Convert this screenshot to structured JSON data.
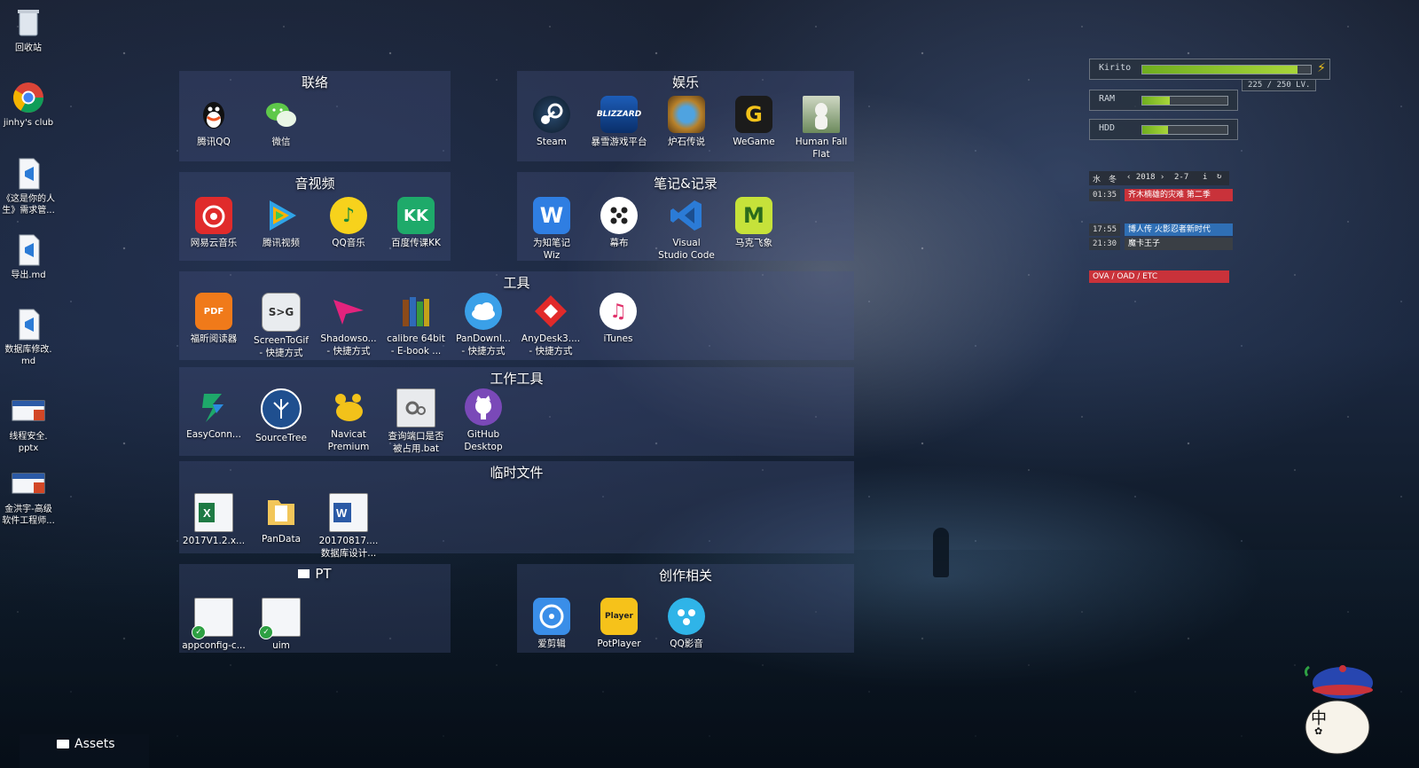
{
  "desktop_icons": [
    {
      "label": "回收站",
      "icon": "recycle-bin-icon"
    },
    {
      "label": "jinhy's club",
      "icon": "chrome-icon"
    },
    {
      "label": "《这是你的人\n生》需求管...",
      "icon": "vscode-file-icon"
    },
    {
      "label": "导出.md",
      "icon": "vscode-file-icon"
    },
    {
      "label": "数据库修改.\nmd",
      "icon": "vscode-file-icon"
    },
    {
      "label": "线程安全.\npptx",
      "icon": "pptx-icon"
    },
    {
      "label": "金洪宇-高级\n软件工程师...",
      "icon": "pptx-icon"
    }
  ],
  "fences": {
    "lianluo": {
      "title": "联络",
      "apps": [
        {
          "label": "腾讯QQ",
          "icon": "qq-icon"
        },
        {
          "label": "微信",
          "icon": "wechat-icon"
        }
      ]
    },
    "yule": {
      "title": "娱乐",
      "apps": [
        {
          "label": "Steam",
          "icon": "steam-icon"
        },
        {
          "label": "暴雪游戏平台",
          "icon": "blizzard-icon"
        },
        {
          "label": "炉石传说",
          "icon": "hearthstone-icon"
        },
        {
          "label": "WeGame",
          "icon": "wegame-icon"
        },
        {
          "label": "Human Fall\nFlat",
          "icon": "human-fall-flat-icon"
        }
      ]
    },
    "yinshipin": {
      "title": "音视频",
      "apps": [
        {
          "label": "网易云音乐",
          "icon": "netease-music-icon"
        },
        {
          "label": "腾讯视频",
          "icon": "tencent-video-icon"
        },
        {
          "label": "QQ音乐",
          "icon": "qq-music-icon"
        },
        {
          "label": "百度传课KK",
          "icon": "baidu-kk-icon"
        }
      ]
    },
    "biji": {
      "title": "笔记&记录",
      "apps": [
        {
          "label": "为知笔记\nWiz",
          "icon": "wiz-icon"
        },
        {
          "label": "幕布",
          "icon": "mubu-icon"
        },
        {
          "label": "Visual\nStudio Code",
          "icon": "vscode-icon"
        },
        {
          "label": "马克飞象",
          "icon": "maxiang-icon"
        }
      ]
    },
    "gongju": {
      "title": "工具",
      "apps": [
        {
          "label": "福昕阅读器",
          "icon": "foxit-icon"
        },
        {
          "label": "ScreenToGif\n- 快捷方式",
          "icon": "screentogif-icon"
        },
        {
          "label": "Shadowso...\n- 快捷方式",
          "icon": "shadowsocks-icon"
        },
        {
          "label": "calibre 64bit\n- E-book ...",
          "icon": "calibre-icon"
        },
        {
          "label": "PanDownl...\n- 快捷方式",
          "icon": "pandownload-icon"
        },
        {
          "label": "AnyDesk3....\n- 快捷方式",
          "icon": "anydesk-icon"
        },
        {
          "label": "iTunes",
          "icon": "itunes-icon"
        }
      ]
    },
    "gongzuo": {
      "title": "工作工具",
      "apps": [
        {
          "label": "EasyConn...",
          "icon": "easyconnect-icon"
        },
        {
          "label": "SourceTree",
          "icon": "sourcetree-icon"
        },
        {
          "label": "Navicat\nPremium",
          "icon": "navicat-icon"
        },
        {
          "label": "查询端口是否\n被占用.bat",
          "icon": "bat-file-icon"
        },
        {
          "label": "GitHub\nDesktop",
          "icon": "github-desktop-icon"
        }
      ]
    },
    "linshi": {
      "title": "临时文件",
      "apps": [
        {
          "label": "2017V1.2.x...",
          "icon": "excel-file-icon"
        },
        {
          "label": "PanData",
          "icon": "folder-icon"
        },
        {
          "label": "20170817....\n数据库设计...",
          "icon": "word-file-icon"
        }
      ]
    },
    "pt": {
      "title": "PT",
      "apps": [
        {
          "label": "appconfig-c...",
          "icon": "synced-file-icon"
        },
        {
          "label": "uim",
          "icon": "synced-file-icon"
        }
      ]
    },
    "chuangzuo": {
      "title": "创作相关",
      "apps": [
        {
          "label": "爱剪辑",
          "icon": "aijianji-icon"
        },
        {
          "label": "PotPlayer",
          "icon": "potplayer-icon"
        },
        {
          "label": "QQ影音",
          "icon": "qq-player-icon"
        }
      ]
    }
  },
  "meters": {
    "kirito": {
      "name": "Kirito",
      "stats": "225 / 250  LV.",
      "level": 0.92
    },
    "ram": {
      "name": "RAM",
      "level": 0.32
    },
    "hdd": {
      "name": "HDD",
      "level": 0.3
    }
  },
  "calendar": {
    "header": [
      "水",
      "冬",
      "‹ 2018 ›",
      "2-7",
      "i",
      "↻"
    ],
    "events": [
      {
        "time": "01:35",
        "title": "齐木楠雄的灾难 第二季",
        "color": "#c9323a"
      },
      {
        "time": "17:55",
        "title": "博人传 火影忍者新时代",
        "color": "#2f6fb5"
      },
      {
        "time": "21:30",
        "title": "魔卡王子",
        "color": "#3a3f45"
      },
      {
        "time": "",
        "title": "OVA / OAD / ETC",
        "color": "#c9323a"
      }
    ]
  },
  "taskbar_folder": {
    "label": "Assets"
  },
  "ime": {
    "label": "中"
  }
}
